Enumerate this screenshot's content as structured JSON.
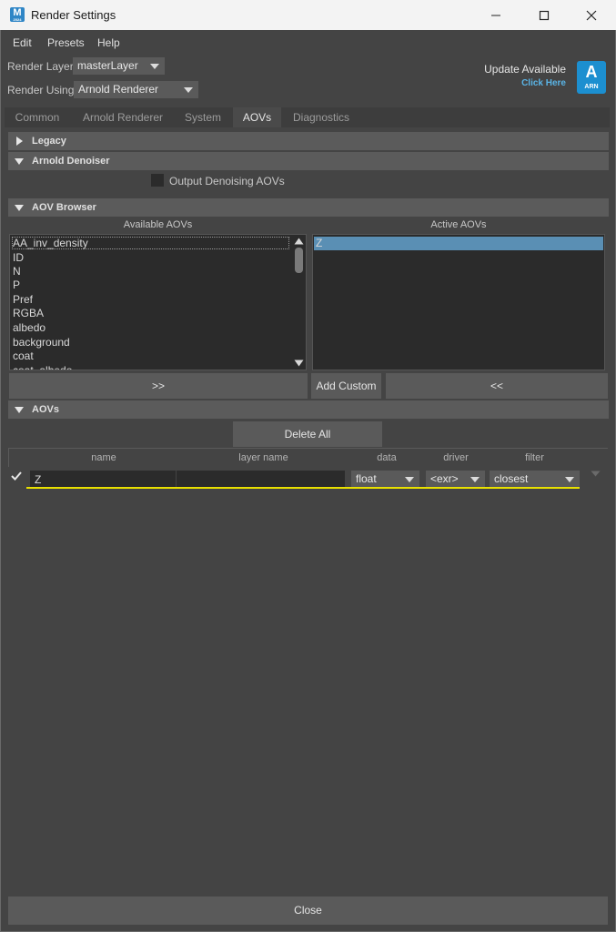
{
  "window": {
    "title": "Render Settings",
    "app_icon": "M",
    "app_icon_sub": "2024",
    "minimize_icon": "minimize-icon",
    "maximize_icon": "maximize-icon",
    "close_icon": "close-icon"
  },
  "menu": [
    "Edit",
    "Presets",
    "Help"
  ],
  "render_layer": {
    "label": "Render Layer",
    "value": "masterLayer"
  },
  "render_using": {
    "label": "Render Using",
    "value": "Arnold Renderer"
  },
  "update": {
    "title": "Update Available",
    "link": "Click Here",
    "logo_letter": "A",
    "logo_text": "ARN"
  },
  "tabs": [
    {
      "label": "Common",
      "active": false
    },
    {
      "label": "Arnold Renderer",
      "active": false
    },
    {
      "label": "System",
      "active": false
    },
    {
      "label": "AOVs",
      "active": true
    },
    {
      "label": "Diagnostics",
      "active": false
    }
  ],
  "sections": {
    "legacy": "Legacy",
    "denoiser": "Arnold Denoiser",
    "aov_browser": "AOV Browser",
    "aovs": "AOVs"
  },
  "denoiser": {
    "output_label": "Output Denoising AOVs",
    "checked": false
  },
  "browser": {
    "available_label": "Available AOVs",
    "active_label": "Active AOVs",
    "available_items": [
      "AA_inv_density",
      "ID",
      "N",
      "P",
      "Pref",
      "RGBA",
      "albedo",
      "background",
      "coat",
      "coat_albedo"
    ],
    "active_items": [
      "Z"
    ],
    "add_button": ">>",
    "add_custom_button": "Add Custom",
    "remove_button": "<<"
  },
  "aovs": {
    "delete_all": "Delete All",
    "columns": {
      "name": "name",
      "layer_name": "layer name",
      "data": "data",
      "driver": "driver",
      "filter": "filter"
    },
    "rows": [
      {
        "enabled": true,
        "name": "Z",
        "layer_name": "",
        "data": "float",
        "driver": "<exr>",
        "filter": "closest"
      }
    ]
  },
  "footer": {
    "close": "Close"
  },
  "colors": {
    "background": "#444444",
    "selection": "#5a8fb4",
    "highlight_underline": "#e8e000",
    "link": "#5ab4e6"
  }
}
